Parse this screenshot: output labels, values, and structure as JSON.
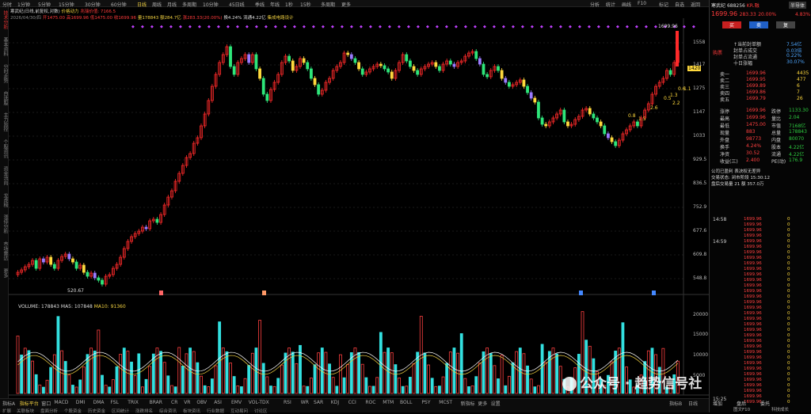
{
  "topbar": {
    "tabs": [
      "分时",
      "1分钟",
      "5分钟",
      "15分钟",
      "30分钟",
      "60分钟",
      "日线",
      "周线",
      "月线",
      "多周期",
      "10分钟",
      "45日线",
      "季线",
      "年线",
      "1秒",
      "15秒",
      "多周期",
      "更多"
    ],
    "active_tab": "日线",
    "right_tabs": [
      "分析",
      "统计",
      "画线",
      "F10",
      "标记",
      "自选",
      "返回"
    ]
  },
  "leftbar": {
    "items": [
      "技术分析",
      "基本资料",
      "分时走势",
      "自选股",
      "主力监控",
      "个股资讯",
      "资金流向",
      "龙虎榜",
      "涨停分析",
      "市场雷达",
      "更多"
    ],
    "active_item": "技术分析"
  },
  "chart_header": {
    "line1": "寒武纪(日线,前复权,对数)",
    "indicator_name": "价格动力",
    "indicator_val": "兆瑞价值: 7166.5",
    "line2_date": "2026/04/30/四",
    "line2_open": "开1475.00",
    "line2_high": "高1699.96",
    "line2_low": "低1475.00",
    "line2_close": "收1699.96",
    "line2_vol": "量178843",
    "line2_amt": "额284.7亿",
    "line2_chg": "涨283.33(20.00%)",
    "line2_turn": "换4.24%",
    "line2_float": "流通4.22亿",
    "line2_extra": "集成电路设计"
  },
  "price_axis": [
    "1558",
    "1417",
    "1275",
    "1147",
    "1033",
    "929.5",
    "836.5",
    "752.9",
    "677.6",
    "609.8",
    "548.8"
  ],
  "price_annotations": {
    "high": "1699.96",
    "low": "520.67",
    "last": "1420"
  },
  "volume_header": {
    "label": "VOLUME: 178843",
    "ma5": "MA5: 107848",
    "ma10": "MA10: 91360"
  },
  "volume_axis": [
    "20000",
    "15000",
    "10000",
    "5000"
  ],
  "x_axis": [
    "2025年",
    "7",
    "8",
    "9",
    "10",
    "11",
    "12",
    "1",
    "2",
    "3",
    "4"
  ],
  "ma_labels": [
    "2.6",
    "1.5",
    "0.8",
    "1.3",
    "0.5",
    "2.2",
    "0.6",
    "1.1"
  ],
  "bottom_tabs": [
    "指标A",
    "指标平台",
    "窗口",
    "MACD",
    "DMI",
    "DMA",
    "FSL",
    "TRIX",
    "BRAR",
    "CR",
    "VR",
    "OBV",
    "ASI",
    "EMV",
    "VOL-TDX",
    "RSI",
    "WR",
    "SAR",
    "KDJ",
    "CCI",
    "ROC",
    "MTM",
    "BOLL",
    "PSY",
    "MCST",
    "新指标",
    "更多",
    "设置"
  ],
  "bottom_active": "指标平台",
  "bottom_row2": [
    "扩展",
    "关联板块",
    "盘面分析",
    "个股资金",
    "历史资金",
    "区间统计",
    "涨跌排名",
    "综合资讯",
    "板块资讯",
    "行业数据",
    "互动易问",
    "讨论区"
  ],
  "bottom_right": [
    "指标B",
    "日线"
  ],
  "right_panel": {
    "stock_name": "寒武纪",
    "stock_code": "688256",
    "tags": "KR.融",
    "header_btn": "半导体",
    "price": "1699.96",
    "change": "283.33",
    "pct": "20.00%",
    "right_pct": "4.83%",
    "buttons": [
      "买",
      "卖",
      "复"
    ],
    "ticket_label": "购票",
    "flows": [
      {
        "label": "↑当前封单额",
        "value": "7.54亿"
      },
      {
        "label": "封单占成交",
        "value": "0.03倍"
      },
      {
        "label": "封单占流通",
        "value": "0.22%"
      },
      {
        "label": "十日涨幅",
        "value": "30.07%"
      }
    ],
    "asks": [
      {
        "name": "卖一",
        "price": "1699.96",
        "vol": "4435"
      },
      {
        "name": "卖二",
        "price": "1699.95",
        "vol": "477"
      },
      {
        "name": "卖三",
        "price": "1699.89",
        "vol": "6"
      },
      {
        "name": "卖四",
        "price": "1699.86",
        "vol": "7"
      },
      {
        "name": "卖五",
        "price": "1699.79",
        "vol": "26"
      }
    ],
    "stats": [
      {
        "l": "涨停",
        "lv": "1699.96",
        "r": "跌停",
        "rv": "1133.30"
      },
      {
        "l": "最高",
        "lv": "1699.96",
        "r": "量比",
        "rv": "2.04"
      },
      {
        "l": "最低",
        "lv": "1475.00",
        "r": "市值",
        "rv": "7168亿"
      },
      {
        "l": "现量",
        "lv": "883",
        "r": "总量",
        "rv": "178843"
      },
      {
        "l": "外盘",
        "lv": "98773",
        "r": "内盘",
        "rv": "80070"
      },
      {
        "l": "换手",
        "lv": "4.24%",
        "r": "股本",
        "rv": "4.22亿"
      },
      {
        "l": "净资",
        "lv": "30.52",
        "r": "流通",
        "rv": "4.22亿"
      },
      {
        "l": "收益(三)",
        "lv": "2.400",
        "r": "PE(动)",
        "rv": "176.9"
      }
    ],
    "announce": "公司已盈利 表决权无差异",
    "status": "交易状态: 闭市阶段 15:30:12",
    "after": "盘后交易量 21  额 357.0万",
    "ticks_time1": "14:58",
    "ticks_time2": "14:59",
    "ticks_time3": "15:25",
    "tick_price": "1699.96",
    "tick_vol": "0",
    "footer": [
      "增加",
      "盘后",
      "委托"
    ],
    "bottom_badges": [
      "图文F10",
      "科技成长"
    ]
  },
  "watermark": "公众号 · 趋势信号社"
}
